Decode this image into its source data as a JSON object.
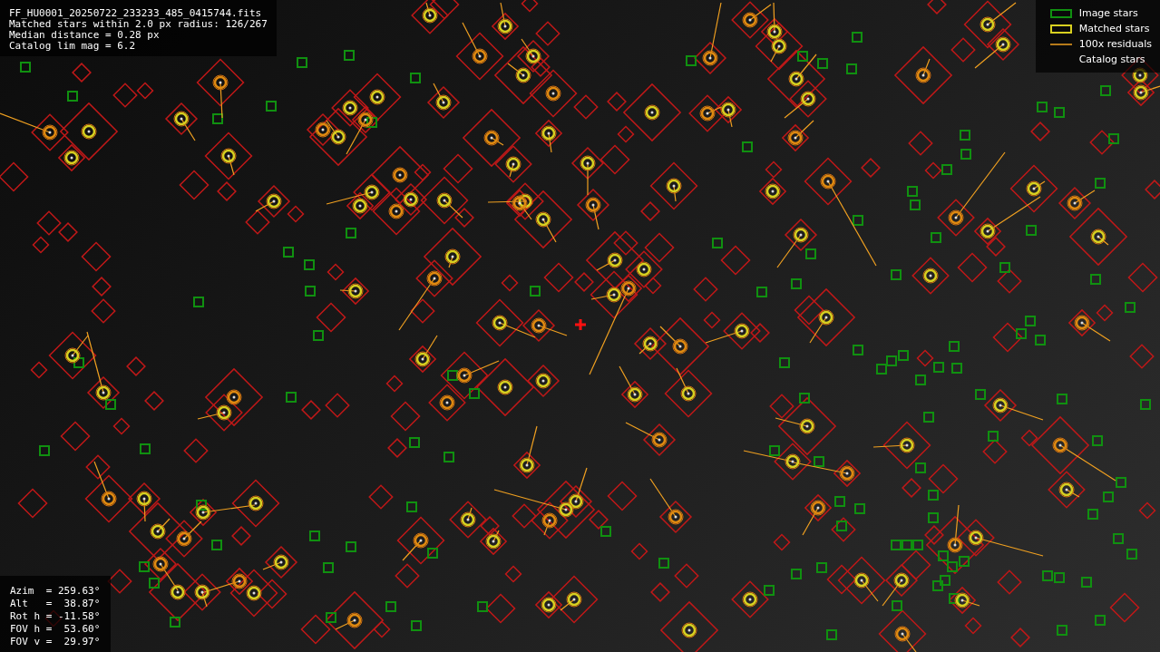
{
  "info": {
    "lines": [
      "FF_HU0001_20250722_233233_485_0415744.fits",
      "Matched stars within 2.0 px radius: 126/267",
      "Median distance = 0.28 px",
      "Catalog lim mag = 6.2"
    ]
  },
  "legend": [
    {
      "kind": "image",
      "label": "Image stars"
    },
    {
      "kind": "matched",
      "label": "Matched stars"
    },
    {
      "kind": "residual",
      "label": "100x residuals"
    },
    {
      "kind": "catalog",
      "label": "Catalog stars"
    }
  ],
  "pointing": {
    "lines": [
      "Azim  = 259.63°",
      "Alt   =  38.87°",
      "Rot h = -11.58°",
      "FOV h =  53.60°",
      "FOV v =  29.97°"
    ]
  }
}
